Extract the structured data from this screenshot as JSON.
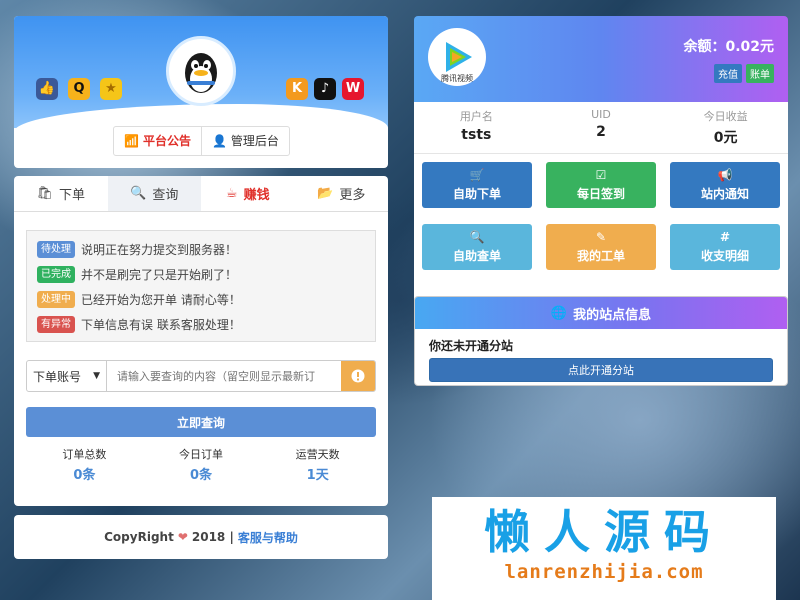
{
  "left": {
    "header": {
      "notice_label": "平台公告",
      "admin_label": "管理后台"
    },
    "tabs": [
      {
        "label": "下单"
      },
      {
        "label": "查询"
      },
      {
        "label": "赚钱"
      },
      {
        "label": "更多"
      }
    ],
    "statuses": [
      {
        "badge": "待处理",
        "text": "说明正在努力提交到服务器！",
        "color": "#5b8fd6"
      },
      {
        "badge": "已完成",
        "text": "并不是刷完了只是开始刷了！",
        "color": "#2fb15f"
      },
      {
        "badge": "处理中",
        "text": "已经开始为您开单 请耐心等！",
        "color": "#f0ad4e"
      },
      {
        "badge": "有异常",
        "text": "下单信息有误 联系客服处理！",
        "color": "#d9534f"
      }
    ],
    "search": {
      "select_label": "下单账号",
      "placeholder": "请输入要查询的内容（留空则显示最新订"
    },
    "query_button": "立即查询",
    "stats": [
      {
        "label": "订单总数",
        "value": "0条"
      },
      {
        "label": "今日订单",
        "value": "0条"
      },
      {
        "label": "运营天数",
        "value": "1天"
      }
    ],
    "footer": {
      "copyright": "CopyRight",
      "year": "2018 |",
      "help_link": "客服与帮助"
    }
  },
  "right": {
    "header": {
      "logo_text": "腾讯视频",
      "balance": "余额：0.02元",
      "recharge_label": "充值",
      "bill_label": "账单"
    },
    "user": [
      {
        "label": "用户名",
        "value": "tsts"
      },
      {
        "label": "UID",
        "value": "2"
      },
      {
        "label": "今日收益",
        "value": "0元"
      }
    ],
    "grid": [
      {
        "label": "自助下单",
        "icon": "cart-icon",
        "color": "#3479c0"
      },
      {
        "label": "每日签到",
        "icon": "check-square-icon",
        "color": "#38b25f"
      },
      {
        "label": "站内通知",
        "icon": "bullhorn-icon",
        "color": "#3479c0"
      },
      {
        "label": "自助查单",
        "icon": "search-icon",
        "color": "#5ab6dc"
      },
      {
        "label": "我的工单",
        "icon": "edit-icon",
        "color": "#f0ad4e"
      },
      {
        "label": "收支明细",
        "icon": "hash-icon",
        "color": "#5ab6dc"
      }
    ],
    "site": {
      "title": "我的站点信息",
      "message": "你还未开通分站",
      "button": "点此开通分站"
    }
  },
  "watermark": {
    "cn": "懒人源码",
    "url": "lanrenzhijia.com"
  }
}
